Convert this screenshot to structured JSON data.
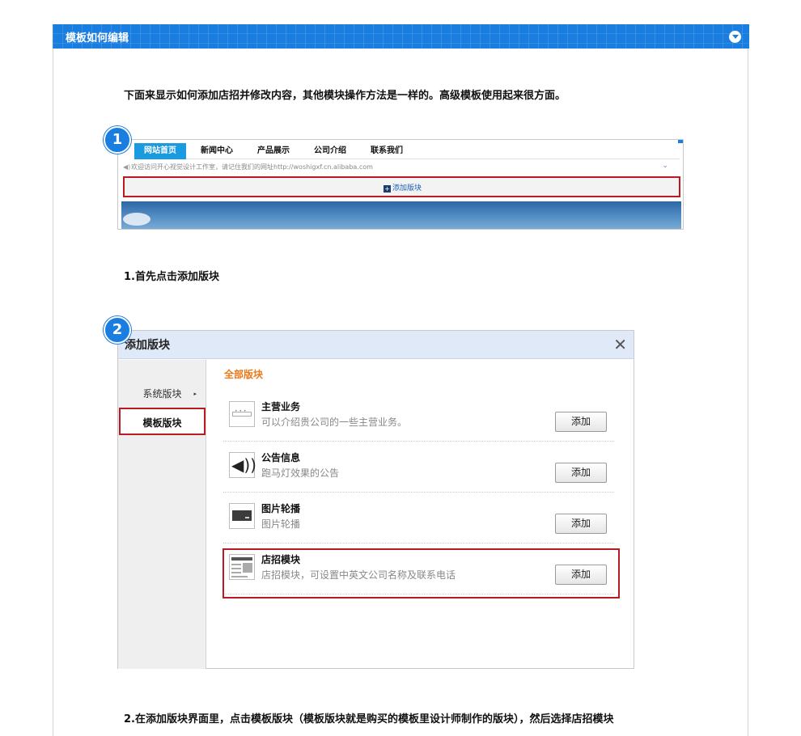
{
  "panel": {
    "title": "模板如何编辑"
  },
  "intro_text": "下面来显示如何添加店招并修改内容，其他模块操作方法是一样的。高级模板使用起来很方面。",
  "step1": {
    "badge": "1",
    "nav_items": [
      "网站首页",
      "新闻中心",
      "产品展示",
      "公司介绍",
      "联系我们"
    ],
    "notice": "欢迎访问开心视觉设计工作室，请记住我们的网址http://woshigxf.cn.alibaba.com",
    "add_block_label": "添加版块",
    "caption": "1.首先点击添加版块"
  },
  "step2": {
    "badge": "2",
    "dialog_title": "添加版块",
    "close_glyph": "✕",
    "sidebar": [
      {
        "label": "系统版块",
        "caret": "▸"
      },
      {
        "label": "模板版块"
      }
    ],
    "section_label": "全部版块",
    "modules": [
      {
        "name": "主营业务",
        "desc": "可以介绍贵公司的一些主营业务。",
        "icon": "layout-strip-icon",
        "button": "添加"
      },
      {
        "name": "公告信息",
        "desc": "跑马灯效果的公告",
        "icon": "speaker-icon",
        "button": "添加"
      },
      {
        "name": "图片轮播",
        "desc": "图片轮播",
        "icon": "slideshow-icon",
        "button": "添加"
      },
      {
        "name": "店招模块",
        "desc": "店招模块，可设置中英文公司名称及联系电话",
        "icon": "signboard-icon",
        "button": "添加"
      }
    ],
    "caption": "2.在添加版块界面里，点击模板版块（模板版块就是购买的模板里设计师制作的版块），然后选择店招模块"
  },
  "colors": {
    "accent": "#1a7de0",
    "highlight": "#b81c22",
    "section_label": "#e8791c"
  }
}
